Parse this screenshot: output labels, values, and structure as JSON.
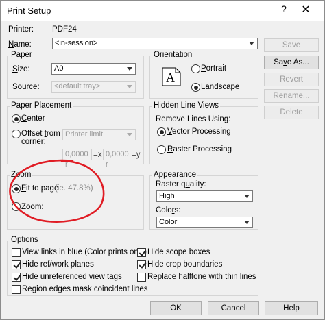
{
  "window": {
    "title": "Print Setup",
    "help_glyph": "?",
    "close_glyph": "✕"
  },
  "printer": {
    "label": "Printer:",
    "value": "PDF24"
  },
  "name": {
    "label": "Name:",
    "value": "<in-session>"
  },
  "buttons": {
    "save": "Save",
    "save_as": "Save As...",
    "revert": "Revert",
    "rename": "Rename...",
    "delete": "Delete",
    "ok": "OK",
    "cancel": "Cancel",
    "help": "Help"
  },
  "paper": {
    "legend": "Paper",
    "size_label": "Size:",
    "size_value": "A0",
    "source_label": "Source:",
    "source_value": "<default tray>"
  },
  "orientation": {
    "legend": "Orientation",
    "icon_letter": "A",
    "portrait": "Portrait",
    "landscape": "Landscape",
    "selected": "landscape"
  },
  "placement": {
    "legend": "Paper Placement",
    "center": "Center",
    "offset_line1": "Offset from",
    "offset_line2": "corner:",
    "offset_combo": "Printer limit",
    "x_value": "0,0000 r",
    "x_label": "=x",
    "y_value": "0,0000 r",
    "y_label": "=y",
    "selected": "center"
  },
  "hidden_lines": {
    "legend": "Hidden Line Views",
    "remove_label": "Remove Lines Using:",
    "vector": "Vector Processing",
    "raster": "Raster Processing",
    "selected": "vector"
  },
  "zoom": {
    "legend": "Zoom",
    "fit": "Fit to page",
    "fit_note": "(ie. 47.8%)",
    "zoom": "Zoom:",
    "selected": "fit",
    "annotation_color": "#e01c24"
  },
  "appearance": {
    "legend": "Appearance",
    "raster_label": "Raster quality:",
    "raster_value": "High",
    "colors_label": "Colors:",
    "colors_value": "Color"
  },
  "options": {
    "legend": "Options",
    "items": [
      {
        "label": "View links in blue (Color prints only)",
        "checked": false
      },
      {
        "label": "Hide ref/work planes",
        "checked": true
      },
      {
        "label": "Hide unreferenced view tags",
        "checked": true
      },
      {
        "label": "Region edges mask coincident lines",
        "checked": false
      },
      {
        "label": "Hide scope boxes",
        "checked": true
      },
      {
        "label": "Hide crop boundaries",
        "checked": true
      },
      {
        "label": "Replace halftone with thin lines",
        "checked": false
      }
    ]
  }
}
